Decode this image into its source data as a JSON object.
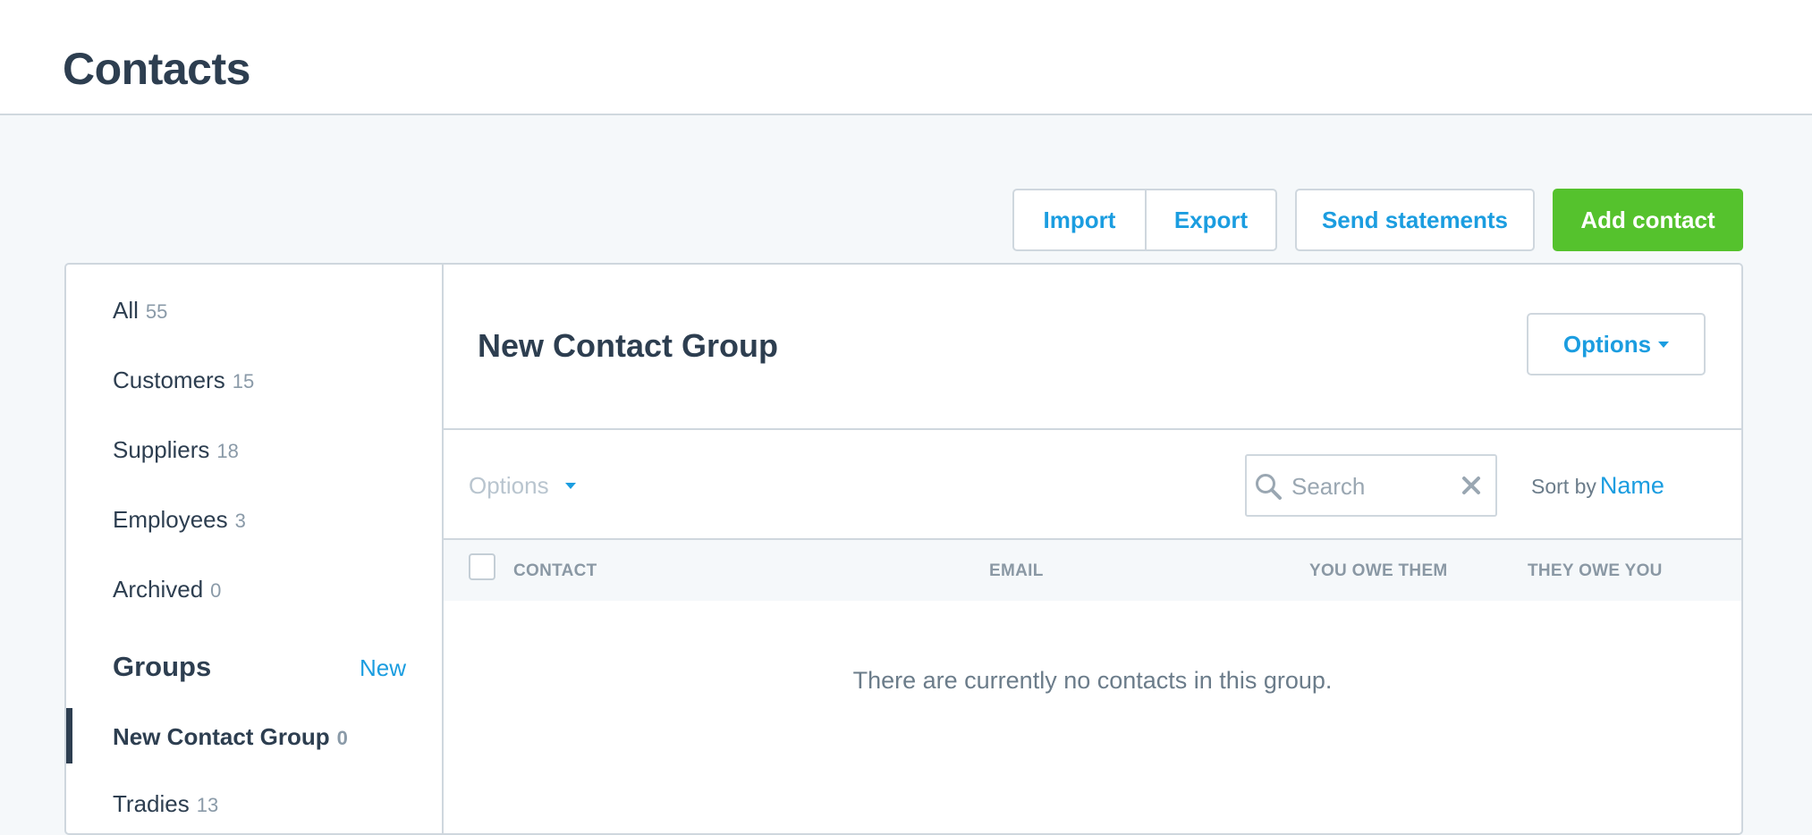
{
  "header": {
    "title": "Contacts"
  },
  "toolbar": {
    "import_label": "Import",
    "export_label": "Export",
    "send_statements_label": "Send statements",
    "add_contact_label": "Add contact"
  },
  "sidebar": {
    "items": [
      {
        "label": "All",
        "count": "55"
      },
      {
        "label": "Customers",
        "count": "15"
      },
      {
        "label": "Suppliers",
        "count": "18"
      },
      {
        "label": "Employees",
        "count": "3"
      },
      {
        "label": "Archived",
        "count": "0"
      }
    ],
    "groups_heading": "Groups",
    "groups_new_label": "New",
    "groups": [
      {
        "label": "New Contact Group",
        "count": "0",
        "active": true
      },
      {
        "label": "Tradies",
        "count": "13"
      }
    ]
  },
  "main": {
    "group_title": "New Contact Group",
    "options_label": "Options",
    "bulk_options_label": "Options",
    "search": {
      "placeholder": "Search",
      "value": ""
    },
    "sort_label": "Sort by",
    "sort_value": "Name",
    "table": {
      "columns": [
        "CONTACT",
        "EMAIL",
        "YOU OWE THEM",
        "THEY OWE YOU"
      ]
    },
    "empty_message": "There are currently no contacts in this group."
  },
  "colors": {
    "accent": "#1b9de0",
    "primary_button": "#55c22d",
    "text_dark": "#2d3e50",
    "border": "#cfd7de"
  }
}
